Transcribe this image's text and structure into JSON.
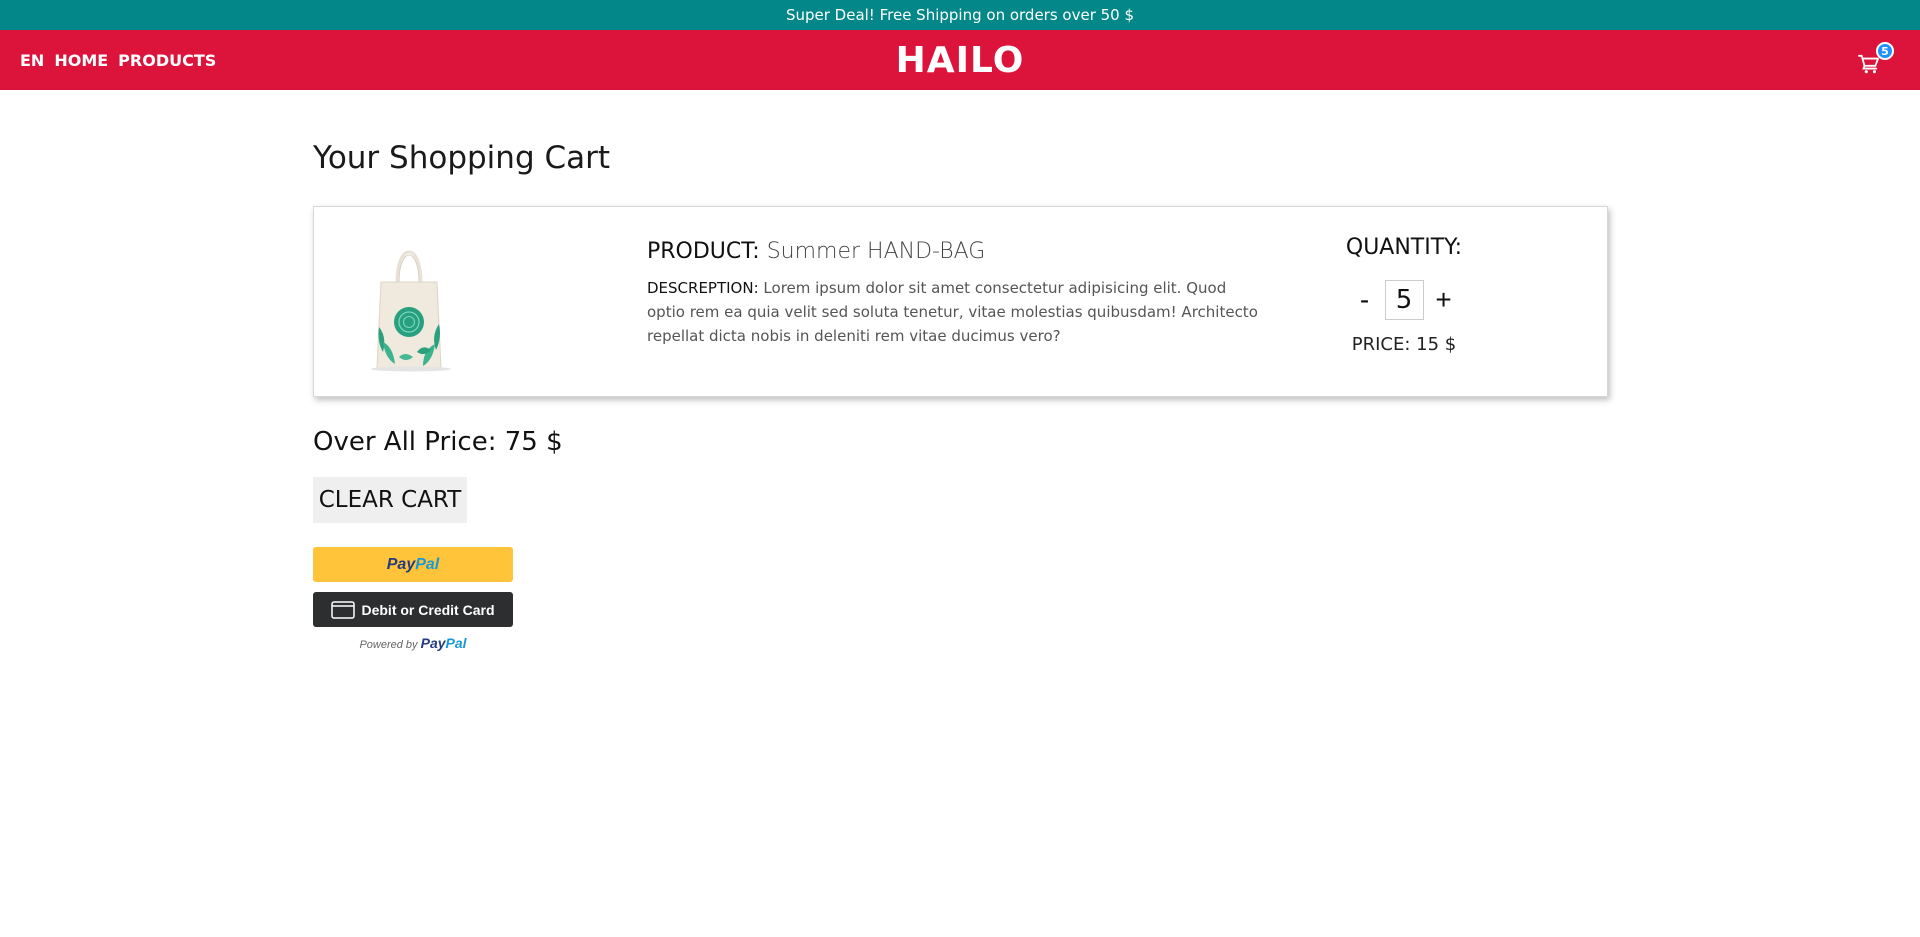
{
  "announcement": "Super Deal! Free Shipping on orders over 50 $",
  "nav": {
    "lang": "EN",
    "home": "HOME",
    "products": "PRODUCTS"
  },
  "brand": "HAILO",
  "cart": {
    "icon": "shopping-cart-icon",
    "count": "5"
  },
  "page": {
    "title": "Your Shopping Cart"
  },
  "item": {
    "product_label": "PRODUCT:",
    "product_name": "Summer HAND-BAG",
    "description_label": "DESCREPTION:",
    "description": "Lorem ipsum dolor sit amet consectetur adipisicing elit. Quod optio rem ea quia velit sed soluta tenetur, vitae molestias quibusdam! Architecto repellat dicta nobis in deleniti rem vitae ducimus vero?",
    "quantity_label": "QUANTITY:",
    "minus": "-",
    "plus": "+",
    "quantity": "5",
    "price": "PRICE: 15 $"
  },
  "summary": {
    "overall": "Over All Price: 75 $",
    "clear_button": "CLEAR CART"
  },
  "paypal": {
    "pay_part1": "Pay",
    "pay_part2": "Pal",
    "card_label": "Debit or Credit Card",
    "powered_by": "Powered by",
    "powered_brand_1": "Pay",
    "powered_brand_2": "Pal"
  },
  "colors": {
    "announcement_bg": "#038788",
    "header_bg": "#dc143c",
    "badge_bg": "#1e90ff",
    "paypal_yellow": "#ffc439",
    "card_button_bg": "#2c2e2f"
  }
}
